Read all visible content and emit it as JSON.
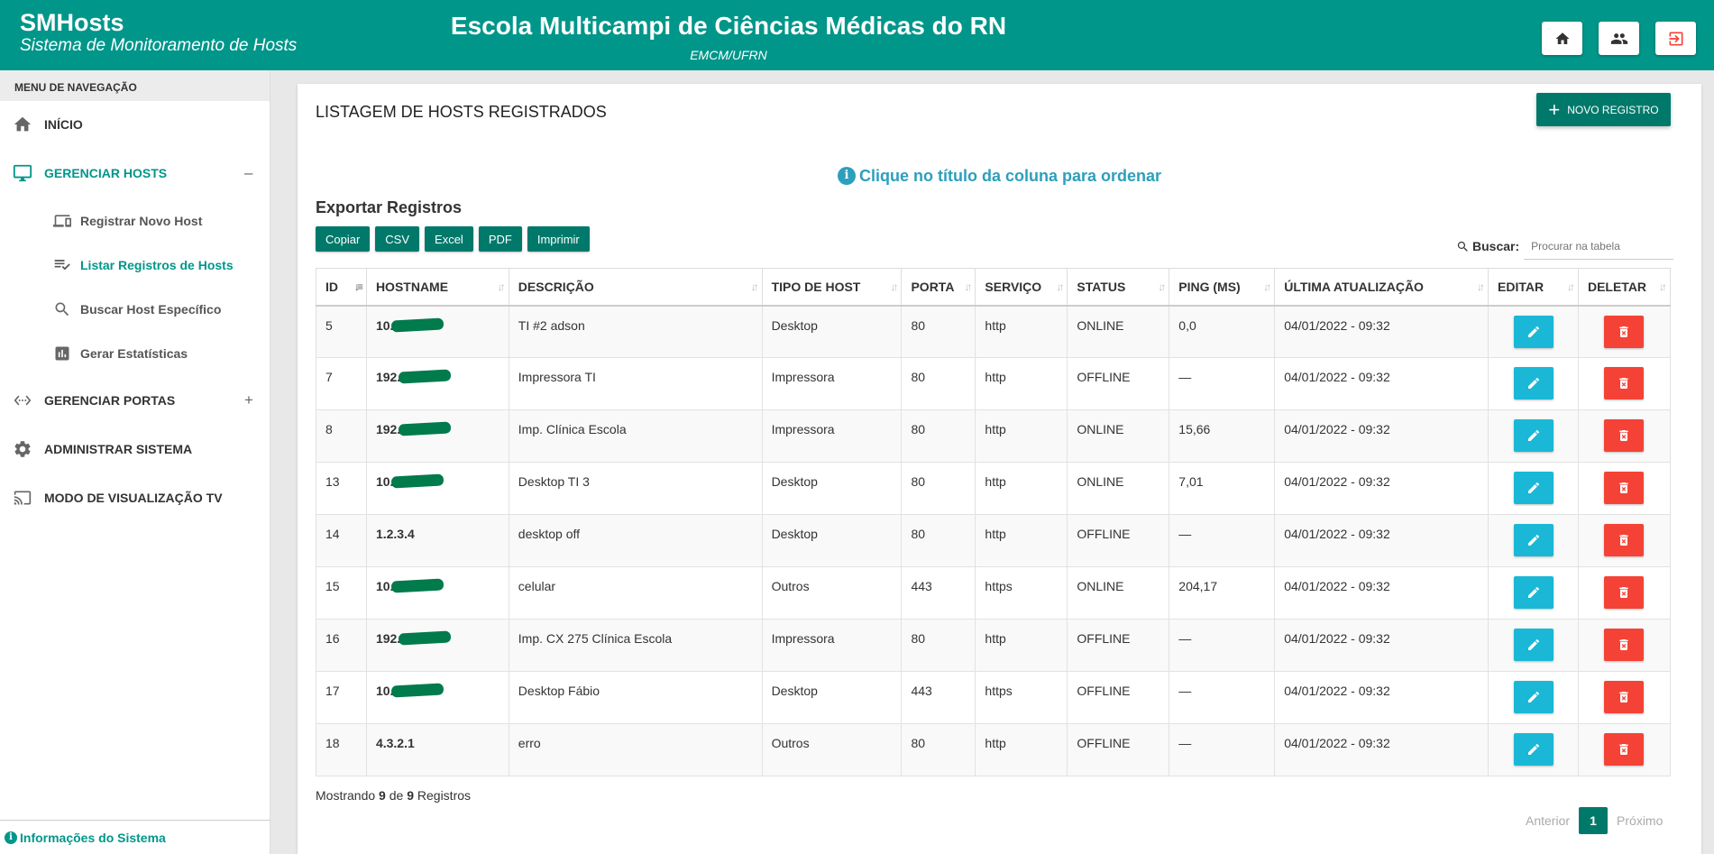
{
  "header": {
    "app_name": "SMHosts",
    "app_subtitle": "Sistema de Monitoramento de Hosts",
    "school_name": "Escola Multicampi de Ciências Médicas do RN",
    "school_short": "EMCM/UFRN",
    "buttons": [
      "home-icon",
      "users-icon",
      "logout-icon"
    ]
  },
  "sidebar": {
    "title": "MENU DE NAVEGAÇÃO",
    "items": [
      {
        "label": "INÍCIO",
        "icon": "home-icon"
      },
      {
        "label": "GERENCIAR HOSTS",
        "icon": "monitor-icon",
        "toggle": "–"
      },
      {
        "label": "Registrar Novo Host",
        "icon": "devices-icon"
      },
      {
        "label": "Listar Registros de Hosts",
        "icon": "list-check-icon"
      },
      {
        "label": "Buscar Host Específico",
        "icon": "search-icon"
      },
      {
        "label": "Gerar Estatísticas",
        "icon": "chart-icon"
      },
      {
        "label": "GERENCIAR PORTAS",
        "icon": "ethernet-icon",
        "toggle": "+"
      },
      {
        "label": "ADMINISTRAR SISTEMA",
        "icon": "gear-icon"
      },
      {
        "label": "MODO DE VISUALIZAÇÃO TV",
        "icon": "cast-icon"
      }
    ],
    "footer": "Informações do Sistema"
  },
  "main": {
    "title": "LISTAGEM DE HOSTS REGISTRADOS",
    "new_button": "NOVO REGISTRO",
    "hint": "Clique no título da coluna para ordenar",
    "export_title": "Exportar Registros",
    "export_buttons": [
      "Copiar",
      "CSV",
      "Excel",
      "PDF",
      "Imprimir"
    ],
    "search_label": "Buscar:",
    "search_placeholder": "Procurar na tabela",
    "columns": [
      "ID",
      "HOSTNAME",
      "DESCRIÇÃO",
      "TIPO DE HOST",
      "PORTA",
      "SERVIÇO",
      "STATUS",
      "PING (MS)",
      "ÚLTIMA ATUALIZAÇÃO",
      "EDITAR",
      "DELETAR"
    ],
    "rows": [
      {
        "id": "5",
        "hostname": "10.",
        "redacted": true,
        "descricao": "TI #2 adson",
        "tipo": "Desktop",
        "porta": "80",
        "servico": "http",
        "status": "ONLINE",
        "ping": "0,0",
        "atualizacao": "04/01/2022 - 09:32"
      },
      {
        "id": "7",
        "hostname": "192.",
        "redacted": true,
        "descricao": "Impressora TI",
        "tipo": "Impressora",
        "porta": "80",
        "servico": "http",
        "status": "OFFLINE",
        "ping": "—",
        "atualizacao": "04/01/2022 - 09:32"
      },
      {
        "id": "8",
        "hostname": "192.",
        "redacted": true,
        "descricao": "Imp. Clínica Escola",
        "tipo": "Impressora",
        "porta": "80",
        "servico": "http",
        "status": "ONLINE",
        "ping": "15,66",
        "atualizacao": "04/01/2022 - 09:32"
      },
      {
        "id": "13",
        "hostname": "10.",
        "redacted": true,
        "descricao": "Desktop TI 3",
        "tipo": "Desktop",
        "porta": "80",
        "servico": "http",
        "status": "ONLINE",
        "ping": "7,01",
        "atualizacao": "04/01/2022 - 09:32"
      },
      {
        "id": "14",
        "hostname": "1.2.3.4",
        "redacted": false,
        "descricao": "desktop off",
        "tipo": "Desktop",
        "porta": "80",
        "servico": "http",
        "status": "OFFLINE",
        "ping": "—",
        "atualizacao": "04/01/2022 - 09:32"
      },
      {
        "id": "15",
        "hostname": "10.",
        "redacted": true,
        "descricao": "celular",
        "tipo": "Outros",
        "porta": "443",
        "servico": "https",
        "status": "ONLINE",
        "ping": "204,17",
        "atualizacao": "04/01/2022 - 09:32"
      },
      {
        "id": "16",
        "hostname": "192.",
        "redacted": true,
        "descricao": "Imp. CX 275 Clínica Escola",
        "tipo": "Impressora",
        "porta": "80",
        "servico": "http",
        "status": "OFFLINE",
        "ping": "—",
        "atualizacao": "04/01/2022 - 09:32"
      },
      {
        "id": "17",
        "hostname": "10.",
        "redacted": true,
        "descricao": "Desktop Fábio",
        "tipo": "Desktop",
        "porta": "443",
        "servico": "https",
        "status": "OFFLINE",
        "ping": "—",
        "atualizacao": "04/01/2022 - 09:32"
      },
      {
        "id": "18",
        "hostname": "4.3.2.1",
        "redacted": false,
        "descricao": "erro",
        "tipo": "Outros",
        "porta": "80",
        "servico": "http",
        "status": "OFFLINE",
        "ping": "—",
        "atualizacao": "04/01/2022 - 09:32"
      }
    ],
    "footer_prefix": "Mostrando",
    "footer_shown": "9",
    "footer_of": "de",
    "footer_total": "9",
    "footer_suffix": "Registros",
    "pager": {
      "prev": "Anterior",
      "current": "1",
      "next": "Próximo"
    }
  },
  "colors": {
    "primary": "#00968a",
    "primary_dark": "#00796b",
    "edit": "#1ab8d6",
    "delete": "#f44336",
    "hint": "#2c9fbd"
  }
}
